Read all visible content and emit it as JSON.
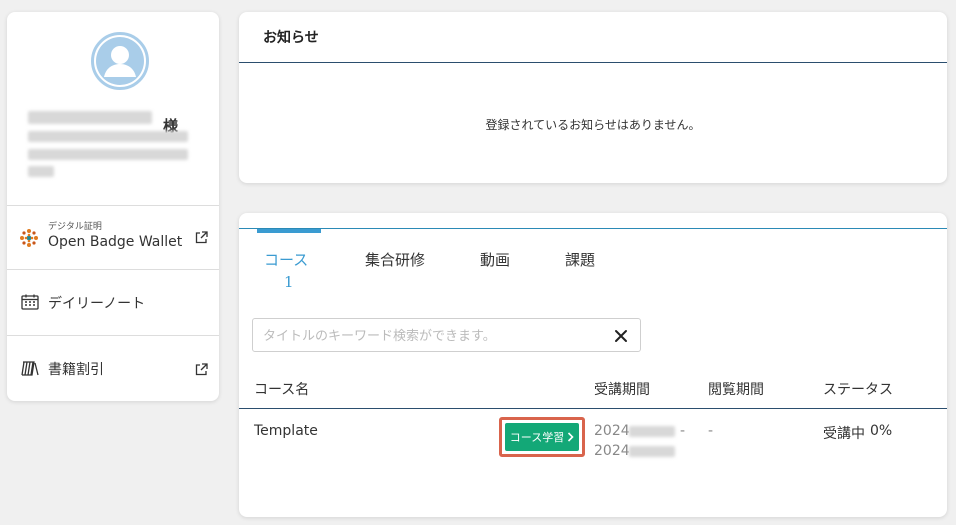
{
  "profile": {
    "name_suffix": "様",
    "links": [
      {
        "sub_label": "デジタル証明",
        "label": "Open Badge Wallet",
        "icon": "open-badge-logo-icon",
        "external": true
      },
      {
        "label": "デイリーノート",
        "icon": "calendar-icon",
        "external": false
      },
      {
        "label": "書籍割引",
        "icon": "books-icon",
        "external": true
      }
    ]
  },
  "notice": {
    "title": "お知らせ",
    "empty_message": "登録されているお知らせはありません。"
  },
  "courses": {
    "tabs": [
      {
        "label": "コース",
        "count": "1",
        "active": true
      },
      {
        "label": "集合研修",
        "active": false
      },
      {
        "label": "動画",
        "active": false
      },
      {
        "label": "課題",
        "active": false
      }
    ],
    "search": {
      "placeholder": "タイトルのキーワード検索ができます。",
      "value": ""
    },
    "columns": {
      "name": "コース名",
      "period": "受講期間",
      "viewing": "閲覧期間",
      "status": "ステータス"
    },
    "rows": [
      {
        "name": "Template",
        "study_button": "コース学習",
        "period_start": "2024",
        "period_sep": "-",
        "period_end": "2024",
        "viewing": "-",
        "status": "受講中",
        "progress": "0%"
      }
    ]
  },
  "colors": {
    "accent_blue": "#3a9bd1",
    "study_button_green": "#13a877",
    "highlight_outline": "#d9644c",
    "rule_navy": "#2b4e6e"
  }
}
